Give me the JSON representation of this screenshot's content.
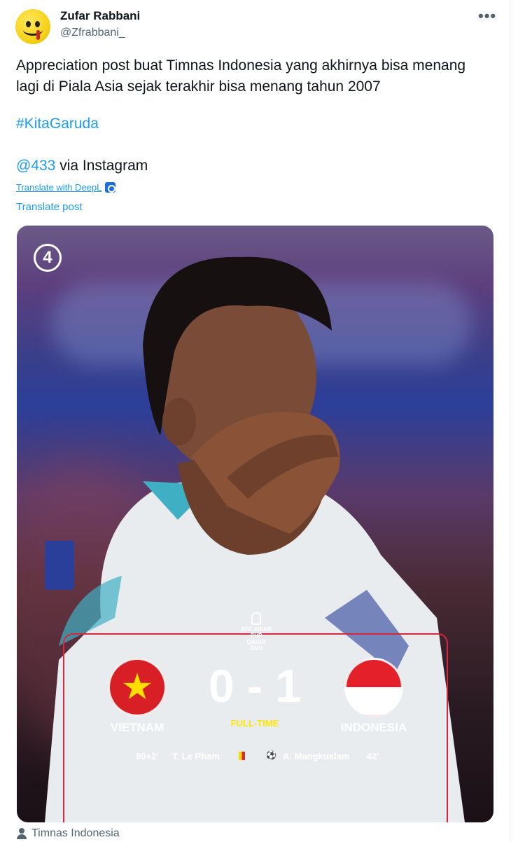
{
  "author": {
    "name": "Zufar Rabbani",
    "handle": "@Zfrabbani_"
  },
  "more_icon": "more-horizontal-icon",
  "tweet": {
    "text": "Appreciation post buat Timnas Indonesia yang akhirnya bisa menang lagi di Piala Asia sejak terakhir bisa menang tahun 2007",
    "hashtag": "#KitaGaruda",
    "mention": "@433",
    "via_text": " via Instagram",
    "deepl_label": "Translate with DeepL",
    "translate_label": "Translate post"
  },
  "media": {
    "badge": "4",
    "afc_logo_text": "AFC ASIAN CUP QATAR 2023",
    "home_team": "VIETNAM",
    "away_team": "INDONESIA",
    "home_score": "0",
    "separator": "-",
    "away_score": "1",
    "status": "FULL-TIME",
    "home_event_minute": "90+2'",
    "home_event_player": "T. Le Pham",
    "away_event_player": "A. Mangkualam",
    "away_event_minute": "42'",
    "colors": {
      "border": "#d7263d",
      "status": "#ffe600"
    }
  },
  "caption": "Timnas Indonesia"
}
